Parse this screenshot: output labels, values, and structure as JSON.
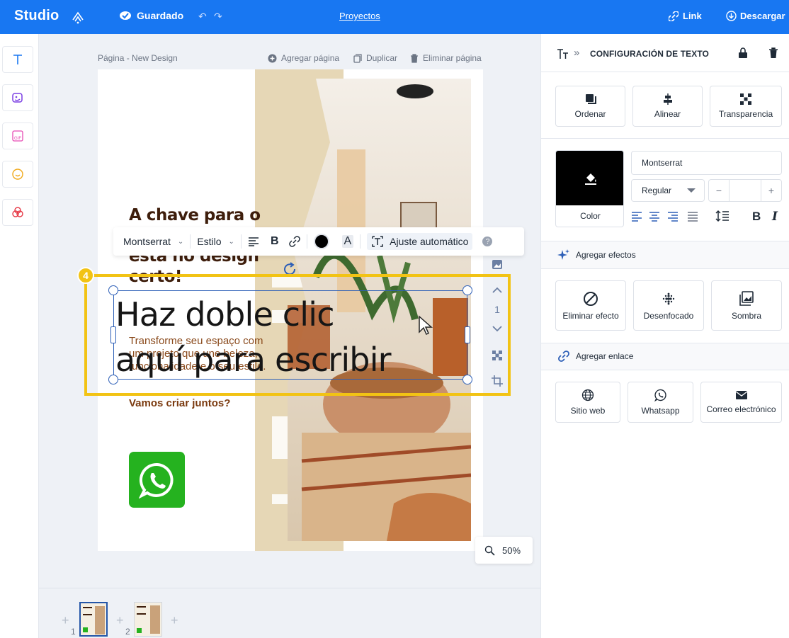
{
  "topbar": {
    "app_name": "Studio",
    "saved_label": "Guardado",
    "projects_label": "Proyectos",
    "link_label": "Link",
    "download_label": "Descargar"
  },
  "canvas": {
    "page_label": "Página - New Design",
    "add_page_label": "Agregar página",
    "duplicate_label": "Duplicar",
    "delete_page_label": "Eliminar página",
    "zoom": "50%"
  },
  "design": {
    "heading": "A chave para o espaço perfeito está no design certo!",
    "body": "Transforme seu espaço com um projeto que une beleza, funcionalidade e o seu estilo.",
    "cta": "Vamos criar juntos?",
    "placeholder_line1": "Haz doble clic",
    "placeholder_line2": "aquí para escribir",
    "step_badge": "4",
    "layer_index": "1"
  },
  "text_toolbar": {
    "font": "Montserrat",
    "style": "Estilo",
    "auto_fit": "Ajuste automático",
    "color": "#000000"
  },
  "page_strip": {
    "pages": [
      {
        "number": "1",
        "active": true
      },
      {
        "number": "2",
        "active": false
      }
    ]
  },
  "panel": {
    "title": "CONFIGURACIÓN DE TEXTO",
    "arrange_label": "Ordenar",
    "align_label": "Alinear",
    "transparency_label": "Transparencia",
    "color_label": "Color",
    "font_value": "Montserrat",
    "weight_value": "Regular",
    "size_minus": "−",
    "size_plus": "+",
    "add_effects_label": "Agregar efectos",
    "remove_effect_label": "Eliminar efecto",
    "blur_label": "Desenfocado",
    "shadow_label": "Sombra",
    "add_link_label": "Agregar enlace",
    "website_label": "Sitio web",
    "whatsapp_label": "Whatsapp",
    "email_label": "Correo electrónico"
  },
  "colors": {
    "topbar": "#1877f2",
    "highlight": "#f2c314",
    "selection": "#2d5fb7",
    "text_color": "#000000",
    "whatsapp": "#25b21f"
  }
}
